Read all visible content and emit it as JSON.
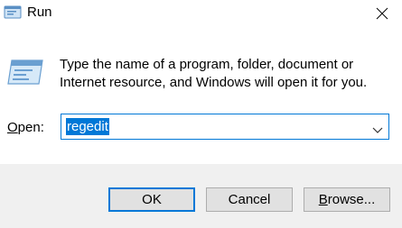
{
  "window": {
    "title": "Run",
    "title_icon": "run-dialog-icon",
    "close_icon": "close-icon"
  },
  "main": {
    "icon": "run-program-icon",
    "description": "Type the name of a program, folder, document or Internet resource, and Windows will open it for you.",
    "open_label_underlined": "O",
    "open_label_rest": "pen:",
    "open_value": "regedit",
    "dropdown_icon": "chevron-down-icon"
  },
  "buttons": {
    "ok": "OK",
    "cancel": "Cancel",
    "browse_underlined": "B",
    "browse_rest": "rowse..."
  },
  "colors": {
    "accent": "#0078d7",
    "footer_bg": "#f0f0f0",
    "button_bg": "#e1e1e1"
  }
}
